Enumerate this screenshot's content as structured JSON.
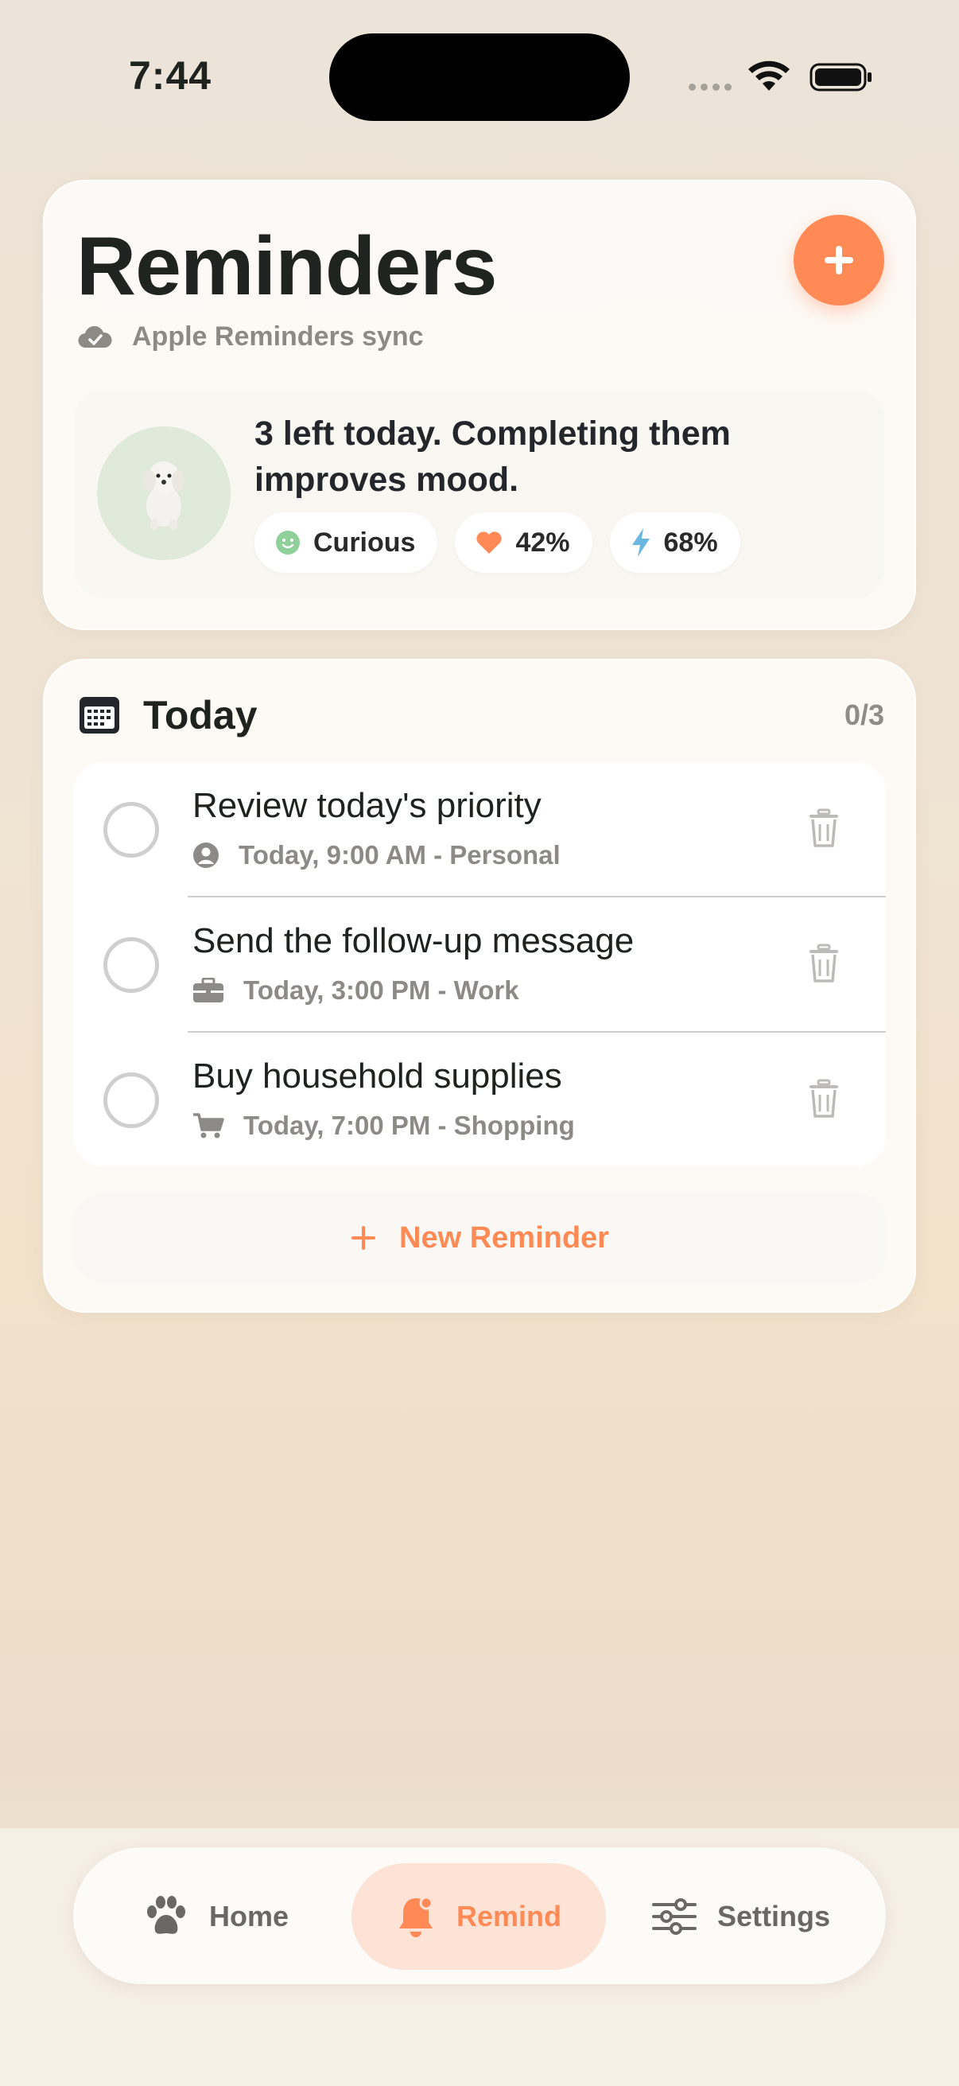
{
  "status": {
    "time": "7:44"
  },
  "header": {
    "title": "Reminders",
    "sync_label": "Apple Reminders sync",
    "add_icon": "plus-icon"
  },
  "mood": {
    "message": "3 left today. Completing them improves mood.",
    "chips": [
      {
        "icon": "smile-icon",
        "label": "Curious"
      },
      {
        "icon": "heart-icon",
        "label": "42%"
      },
      {
        "icon": "bolt-icon",
        "label": "68%"
      }
    ]
  },
  "today": {
    "title": "Today",
    "count": "0/3",
    "items": [
      {
        "title": "Review today's priority",
        "meta": "Today, 9:00 AM - Personal",
        "category_icon": "person-icon"
      },
      {
        "title": "Send the follow-up message",
        "meta": "Today, 3:00 PM - Work",
        "category_icon": "briefcase-icon"
      },
      {
        "title": "Buy household supplies",
        "meta": "Today, 7:00 PM - Shopping",
        "category_icon": "cart-icon"
      }
    ],
    "new_label": "New Reminder"
  },
  "tabs": [
    {
      "label": "Home",
      "icon": "paw-icon"
    },
    {
      "label": "Remind",
      "icon": "bell-icon",
      "selected": true
    },
    {
      "label": "Settings",
      "icon": "sliders-icon"
    }
  ],
  "colors": {
    "accent": "#ff8a55",
    "text": "#1f2320",
    "muted": "#8c8a86"
  }
}
